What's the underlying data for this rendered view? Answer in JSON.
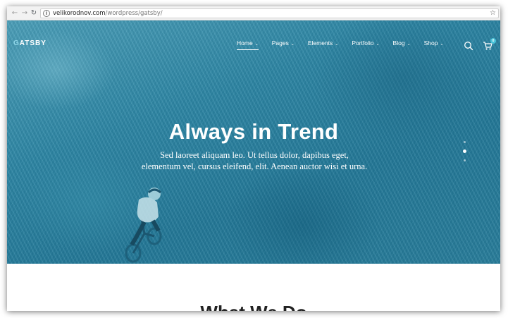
{
  "browser": {
    "url_domain": "velikorodnov.com",
    "url_path": "/wordpress/gatsby/",
    "back_icon": "←",
    "forward_icon": "→",
    "reload_icon": "↻",
    "info_icon": "i",
    "star_icon": "☆"
  },
  "site": {
    "logo_first": "G",
    "logo_rest": "ATSBY",
    "menu": [
      {
        "label": "Home",
        "active": true
      },
      {
        "label": "Pages",
        "active": false
      },
      {
        "label": "Elements",
        "active": false
      },
      {
        "label": "Portfolio",
        "active": false
      },
      {
        "label": "Blog",
        "active": false
      },
      {
        "label": "Shop",
        "active": false
      }
    ],
    "caret": "⌄",
    "cart_count": "0"
  },
  "hero": {
    "title": "Always in Trend",
    "subtitle_line1": "Sed laoreet aliquam leo. Ut tellus dolor, dapibus eget,",
    "subtitle_line2": "elementum vel, cursus eleifend, elit. Aenean auctor wisi et urna.",
    "slides_total": 3,
    "slide_active": 2
  },
  "section": {
    "heading": "What We Do"
  },
  "colors": {
    "hero_overlay": "#2f88a6",
    "accent": "#49c3d9"
  }
}
